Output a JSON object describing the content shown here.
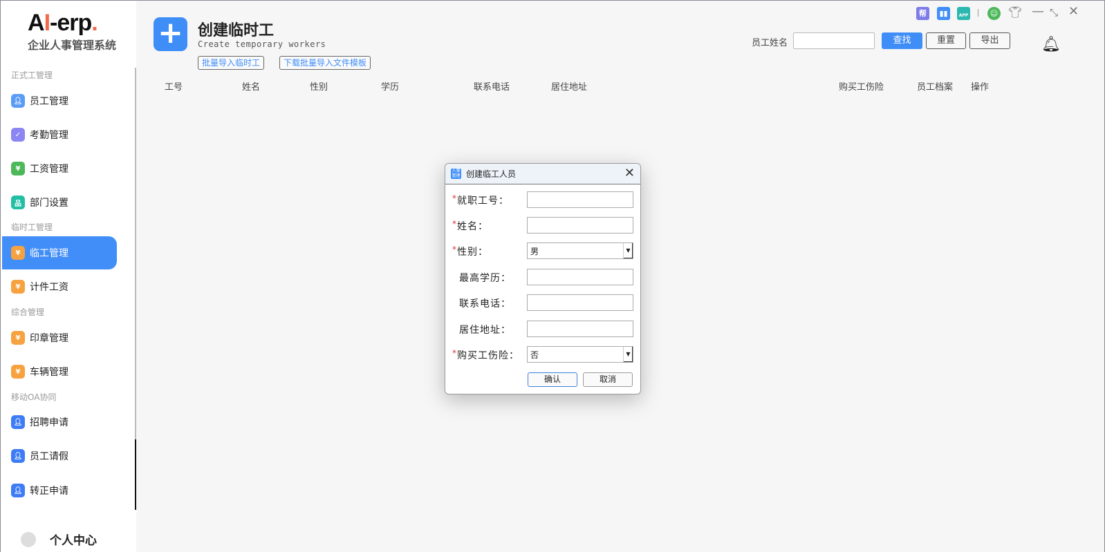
{
  "sidebar": {
    "logo": {
      "prefix": "A",
      "accent": "I",
      "rest": "-erp",
      "dot": "."
    },
    "subtitle": "企业人事管理系统",
    "sections": [
      "正式工管理",
      "临时工管理",
      "综合管理",
      "移动OA协同"
    ],
    "items": [
      {
        "label": "员工管理",
        "icon": "user-icon",
        "color": "#5b9cf7"
      },
      {
        "label": "考勤管理",
        "icon": "location-check-icon",
        "color": "#8b86f2"
      },
      {
        "label": "工资管理",
        "icon": "yuan-icon",
        "color": "#4cb85a"
      },
      {
        "label": "部门设置",
        "icon": "org-chart-icon",
        "color": "#22bfa5"
      },
      {
        "label": "临工管理",
        "icon": "yuan-icon",
        "color": "#f7a240"
      },
      {
        "label": "计件工资",
        "icon": "yuan-icon",
        "color": "#f7a240"
      },
      {
        "label": "印章管理",
        "icon": "yuan-icon",
        "color": "#f7a240"
      },
      {
        "label": "车辆管理",
        "icon": "yuan-icon",
        "color": "#f7a240"
      },
      {
        "label": "招聘申请",
        "icon": "user-apply-icon",
        "color": "#3d7cf5"
      },
      {
        "label": "员工请假",
        "icon": "user-leave-icon",
        "color": "#3d7cf5"
      },
      {
        "label": "转正申请",
        "icon": "user-regular-icon",
        "color": "#3d7cf5"
      }
    ],
    "personal_center": "个人中心"
  },
  "header": {
    "title": "创建临时工",
    "subtitle": "Create temporary workers",
    "import_btn": "批量导入临时工",
    "template_btn": "下载批量导入文件模板",
    "filter_label": "员工姓名",
    "filter_value": "",
    "search": "查找",
    "reset": "重置",
    "export": "导出",
    "toolbar": {
      "help": "帮",
      "app": "APP"
    }
  },
  "table": {
    "columns": [
      "工号",
      "姓名",
      "性别",
      "学历",
      "联系电话",
      "居住地址",
      "购买工伤险",
      "员工档案",
      "操作"
    ],
    "rows": []
  },
  "dialog": {
    "title": "创建临工人员",
    "icon_text": "人事管理",
    "fields": [
      {
        "label": "就职工号：",
        "required": true,
        "value": ""
      },
      {
        "label": "姓名：",
        "required": true,
        "value": ""
      },
      {
        "label": "性别：",
        "required": true,
        "value": "男",
        "select": true
      },
      {
        "label": "最高学历：",
        "required": false,
        "value": ""
      },
      {
        "label": "联系电话：",
        "required": false,
        "value": ""
      },
      {
        "label": "居住地址：",
        "required": false,
        "value": ""
      },
      {
        "label": "购买工伤险：",
        "required": true,
        "value": "否",
        "select": true
      }
    ],
    "ok": "确认",
    "cancel": "取消",
    "required_mark": "*"
  },
  "colors": {
    "accent": "#3f8ef8",
    "required": "#dd3333"
  }
}
